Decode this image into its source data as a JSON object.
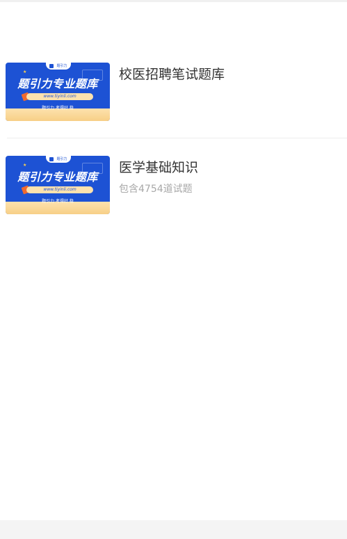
{
  "items": [
    {
      "thumbnail": {
        "badge": "题引力",
        "title": "题引力专业题库",
        "url": "www.tiyinli.com",
        "slogan": "题引力 考得好 稳",
        "colors": {
          "background": "#1d52d4",
          "band": "#f7cf86"
        }
      },
      "title": "校医招聘笔试题库",
      "subtitle": ""
    },
    {
      "thumbnail": {
        "badge": "题引力",
        "title": "题引力专业题库",
        "url": "www.tiyinli.com",
        "slogan": "题引力 考得好 稳",
        "colors": {
          "background": "#1d52d4",
          "band": "#f7cf86"
        }
      },
      "title": "医学基础知识",
      "subtitle": "包含4754道试题"
    }
  ]
}
